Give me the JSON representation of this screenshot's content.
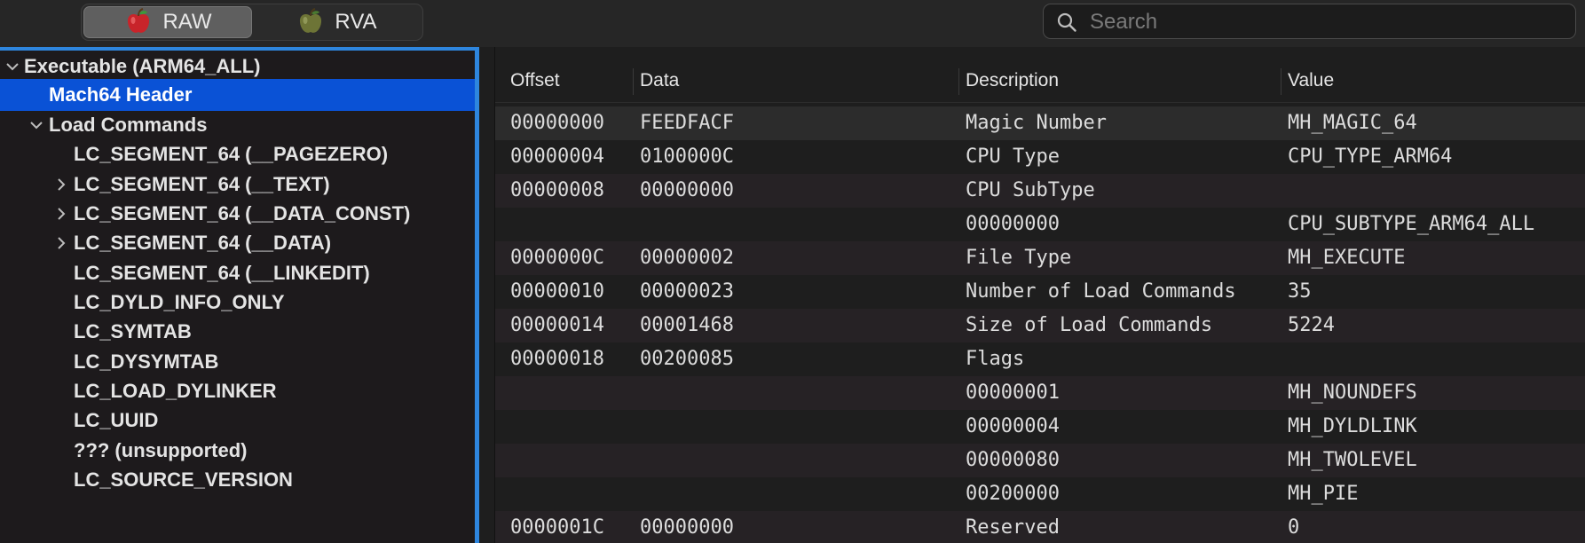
{
  "toolbar": {
    "segments": [
      {
        "label": "RAW",
        "icon": "red-apple-icon",
        "selected": true
      },
      {
        "label": "RVA",
        "icon": "green-apple-icon",
        "selected": false
      }
    ],
    "search_placeholder": "Search"
  },
  "sidebar": {
    "items": [
      {
        "label": "Executable  (ARM64_ALL)",
        "chevron": "down",
        "indent": 0
      },
      {
        "label": "Mach64 Header",
        "chevron": "none",
        "indent": 1,
        "selected": true
      },
      {
        "label": "Load Commands",
        "chevron": "down",
        "indent": 1
      },
      {
        "label": "LC_SEGMENT_64 (__PAGEZERO)",
        "chevron": "none",
        "indent": 2
      },
      {
        "label": "LC_SEGMENT_64 (__TEXT)",
        "chevron": "right",
        "indent": 2
      },
      {
        "label": "LC_SEGMENT_64 (__DATA_CONST)",
        "chevron": "right",
        "indent": 2
      },
      {
        "label": "LC_SEGMENT_64 (__DATA)",
        "chevron": "right",
        "indent": 2
      },
      {
        "label": "LC_SEGMENT_64 (__LINKEDIT)",
        "chevron": "none",
        "indent": 2
      },
      {
        "label": "LC_DYLD_INFO_ONLY",
        "chevron": "none",
        "indent": 2
      },
      {
        "label": "LC_SYMTAB",
        "chevron": "none",
        "indent": 2
      },
      {
        "label": "LC_DYSYMTAB",
        "chevron": "none",
        "indent": 2
      },
      {
        "label": "LC_LOAD_DYLINKER",
        "chevron": "none",
        "indent": 2
      },
      {
        "label": "LC_UUID",
        "chevron": "none",
        "indent": 2
      },
      {
        "label": "??? (unsupported)",
        "chevron": "none",
        "indent": 2
      },
      {
        "label": "LC_SOURCE_VERSION",
        "chevron": "none",
        "indent": 2
      }
    ]
  },
  "table": {
    "columns": [
      "Offset",
      "Data",
      "Description",
      "Value"
    ],
    "rows": [
      {
        "offset": "00000000",
        "data": "FEEDFACF",
        "description": "Magic Number",
        "value": "MH_MAGIC_64"
      },
      {
        "offset": "00000004",
        "data": "0100000C",
        "description": "CPU Type",
        "value": "CPU_TYPE_ARM64"
      },
      {
        "offset": "00000008",
        "data": "00000000",
        "description": "CPU SubType",
        "value": ""
      },
      {
        "offset": "",
        "data": "",
        "description": "00000000",
        "value": "CPU_SUBTYPE_ARM64_ALL"
      },
      {
        "offset": "0000000C",
        "data": "00000002",
        "description": "File Type",
        "value": "MH_EXECUTE"
      },
      {
        "offset": "00000010",
        "data": "00000023",
        "description": "Number of Load Commands",
        "value": "35"
      },
      {
        "offset": "00000014",
        "data": "00001468",
        "description": "Size of Load Commands",
        "value": "5224"
      },
      {
        "offset": "00000018",
        "data": "00200085",
        "description": "Flags",
        "value": ""
      },
      {
        "offset": "",
        "data": "",
        "description": "00000001",
        "value": "MH_NOUNDEFS"
      },
      {
        "offset": "",
        "data": "",
        "description": "00000004",
        "value": "MH_DYLDLINK"
      },
      {
        "offset": "",
        "data": "",
        "description": "00000080",
        "value": "MH_TWOLEVEL"
      },
      {
        "offset": "",
        "data": "",
        "description": "00200000",
        "value": "MH_PIE"
      },
      {
        "offset": "0000001C",
        "data": "00000000",
        "description": "Reserved",
        "value": "0"
      }
    ]
  },
  "colors": {
    "selection_blue": "#0a52d6",
    "focus_ring": "#2e86de"
  }
}
